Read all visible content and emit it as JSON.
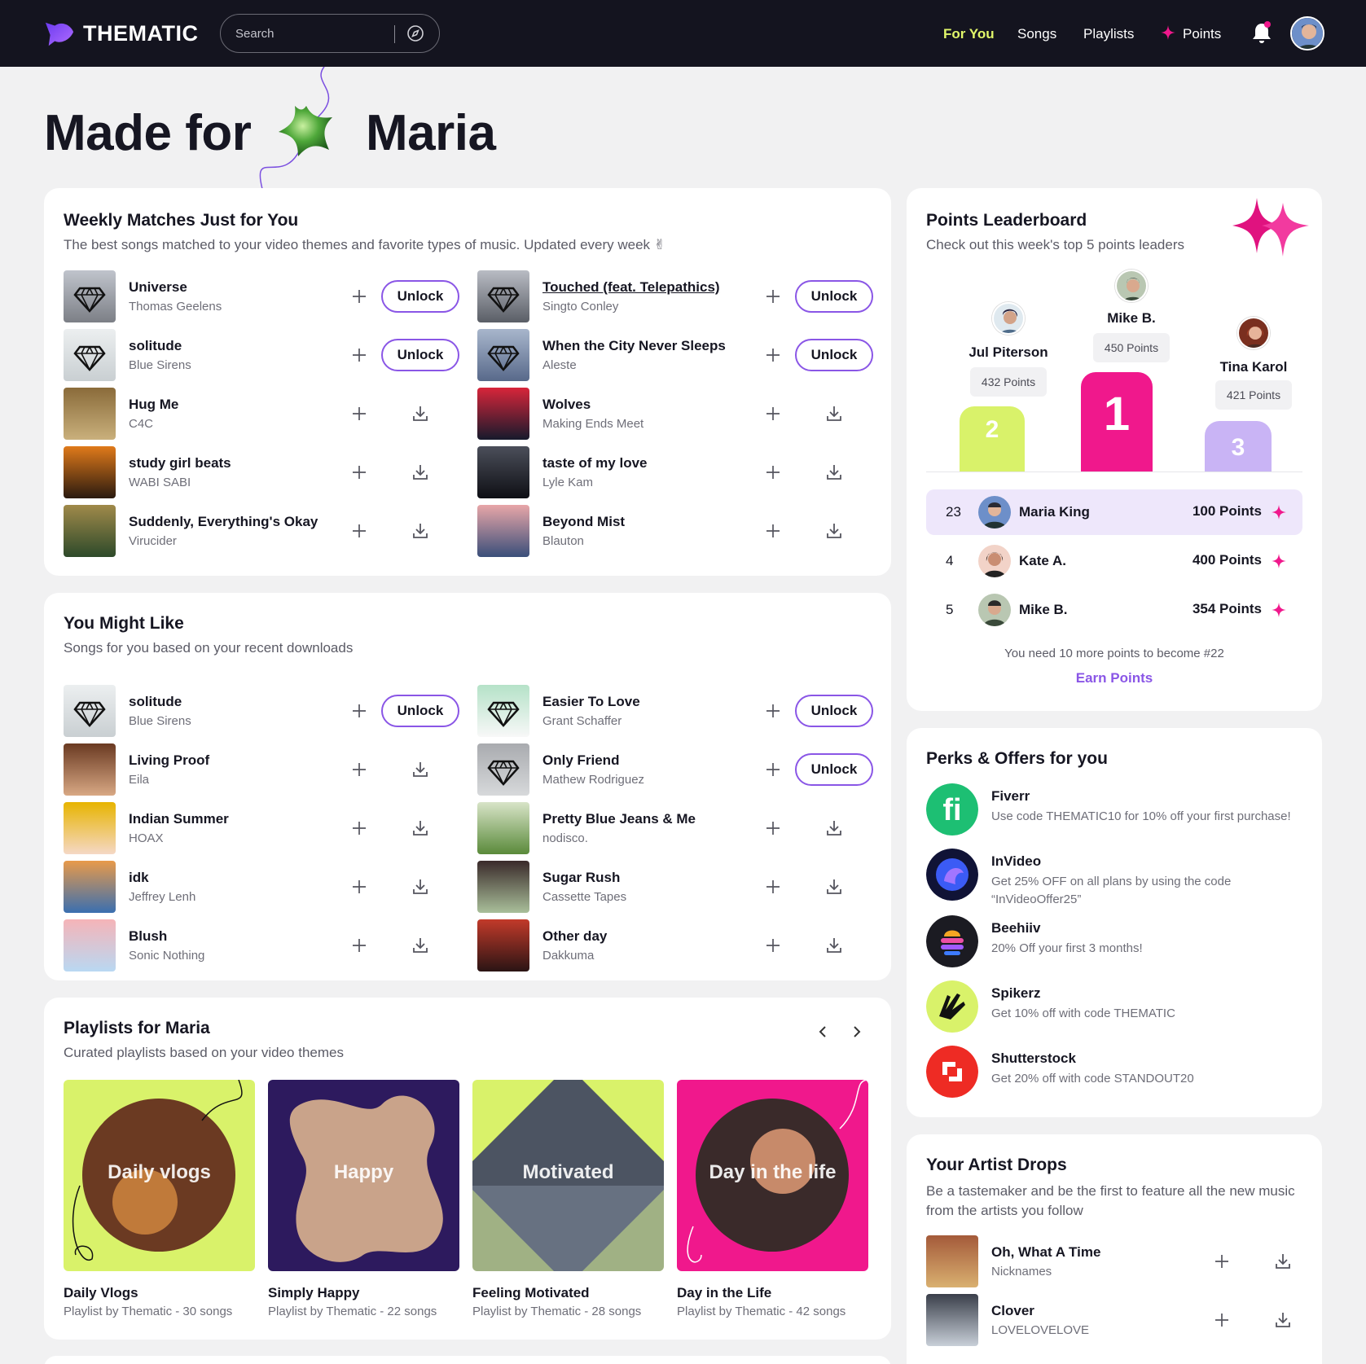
{
  "nav": {
    "brand": "THEMATIC",
    "search_placeholder": "Search",
    "links": [
      "For You",
      "Songs",
      "Playlists",
      "Points"
    ]
  },
  "hero": {
    "made_for": "Made for",
    "name": "Maria"
  },
  "weekly": {
    "title": "Weekly Matches Just for You",
    "subtitle": "The best songs matched to your video themes and favorite types of music. Updated every week ✌",
    "left": [
      {
        "title": "Universe",
        "artist": "Thomas Geelens",
        "action": "Unlock"
      },
      {
        "title": "solitude",
        "artist": "Blue Sirens",
        "action": "Unlock"
      },
      {
        "title": "Hug Me",
        "artist": "C4C",
        "action": "download"
      },
      {
        "title": "study girl beats",
        "artist": "WABI SABI",
        "action": "download"
      },
      {
        "title": "Suddenly, Everything's Okay",
        "artist": "Virucider",
        "action": "download"
      }
    ],
    "right": [
      {
        "title": "Touched (feat. Telepathics)",
        "artist": "Singto Conley",
        "action": "Unlock"
      },
      {
        "title": "When the City Never Sleeps",
        "artist": "Aleste",
        "action": "Unlock"
      },
      {
        "title": "Wolves",
        "artist": "Making Ends Meet",
        "action": "download"
      },
      {
        "title": "taste of my love",
        "artist": "Lyle Kam",
        "action": "download"
      },
      {
        "title": "Beyond Mist",
        "artist": "Blauton",
        "action": "download"
      }
    ]
  },
  "might_like": {
    "title": "You Might Like",
    "subtitle": "Songs for you based on your recent downloads",
    "left": [
      {
        "title": "solitude",
        "artist": "Blue Sirens",
        "action": "Unlock"
      },
      {
        "title": "Living Proof",
        "artist": "Eila",
        "action": "download"
      },
      {
        "title": "Indian Summer",
        "artist": "HOAX",
        "action": "download"
      },
      {
        "title": "idk",
        "artist": "Jeffrey Lenh",
        "action": "download"
      },
      {
        "title": "Blush",
        "artist": "Sonic Nothing",
        "action": "download"
      }
    ],
    "right": [
      {
        "title": "Easier To Love",
        "artist": "Grant Schaffer",
        "action": "Unlock"
      },
      {
        "title": "Only Friend",
        "artist": "Mathew Rodriguez",
        "action": "Unlock"
      },
      {
        "title": "Pretty Blue Jeans & Me",
        "artist": "nodisco.",
        "action": "download"
      },
      {
        "title": "Sugar Rush",
        "artist": "Cassette Tapes",
        "action": "download"
      },
      {
        "title": "Other day",
        "artist": "Dakkuma",
        "action": "download"
      }
    ]
  },
  "playlists": {
    "title": "Playlists for Maria",
    "subtitle": "Curated playlists based on your video themes",
    "items": [
      {
        "label": "Daily vlogs",
        "title": "Daily Vlogs",
        "sub": "Playlist by Thematic - 30 songs",
        "bg": "#d9f26a"
      },
      {
        "label": "Happy",
        "title": "Simply Happy",
        "sub": "Playlist by Thematic - 22 songs",
        "bg": "#2d1a5e"
      },
      {
        "label": "Motivated",
        "title": "Feeling Motivated",
        "sub": "Playlist by Thematic - 28 songs",
        "bg": "#d9f26a"
      },
      {
        "label": "Day in the life",
        "title": "Day in the Life",
        "sub": "Playlist by Thematic - 42 songs",
        "bg": "#f0188c"
      }
    ]
  },
  "leaderboard": {
    "title": "Points Leaderboard",
    "subtitle": "Check out this week's top 5 points leaders",
    "podium": [
      {
        "place": "1",
        "name": "Mike B.",
        "points": "450 Points",
        "color": "#f0188c"
      },
      {
        "place": "2",
        "name": "Jul Piterson",
        "points": "432 Points",
        "color": "#d9f26a"
      },
      {
        "place": "3",
        "name": "Tina Karol",
        "points": "421 Points",
        "color": "#c9b4f5"
      }
    ],
    "rows": [
      {
        "rank": "23",
        "name": "Maria King",
        "points": "100 Points"
      },
      {
        "rank": "4",
        "name": "Kate A.",
        "points": "400 Points"
      },
      {
        "rank": "5",
        "name": "Mike B.",
        "points": "354 Points"
      }
    ],
    "note": "You need 10 more points to become #22",
    "earn": "Earn Points"
  },
  "perks": {
    "title": "Perks & Offers for you",
    "items": [
      {
        "name": "Fiverr",
        "desc": "Use code THEMATIC10 for 10% off your first purchase!"
      },
      {
        "name": "InVideo",
        "desc": "Get 25% OFF on all plans by using the code “InVideoOffer25”"
      },
      {
        "name": "Beehiiv",
        "desc": "20% Off your first 3 months!"
      },
      {
        "name": "Spikerz",
        "desc": "Get 10% off with code THEMATIC"
      },
      {
        "name": "Shutterstock",
        "desc": "Get 20% off with code STANDOUT20"
      }
    ]
  },
  "drops": {
    "title": "Your Artist Drops",
    "subtitle": "Be a tastemaker and be the first to feature all the new music from the artists you follow",
    "items": [
      {
        "title": "Oh, What A Time",
        "artist": "Nicknames"
      },
      {
        "title": "Clover",
        "artist": "LOVELOVELOVE"
      }
    ]
  },
  "colors": {
    "accent": "#8a56e6",
    "lime": "#d9f26a",
    "pink": "#f0188c",
    "nav": "#14141f"
  }
}
